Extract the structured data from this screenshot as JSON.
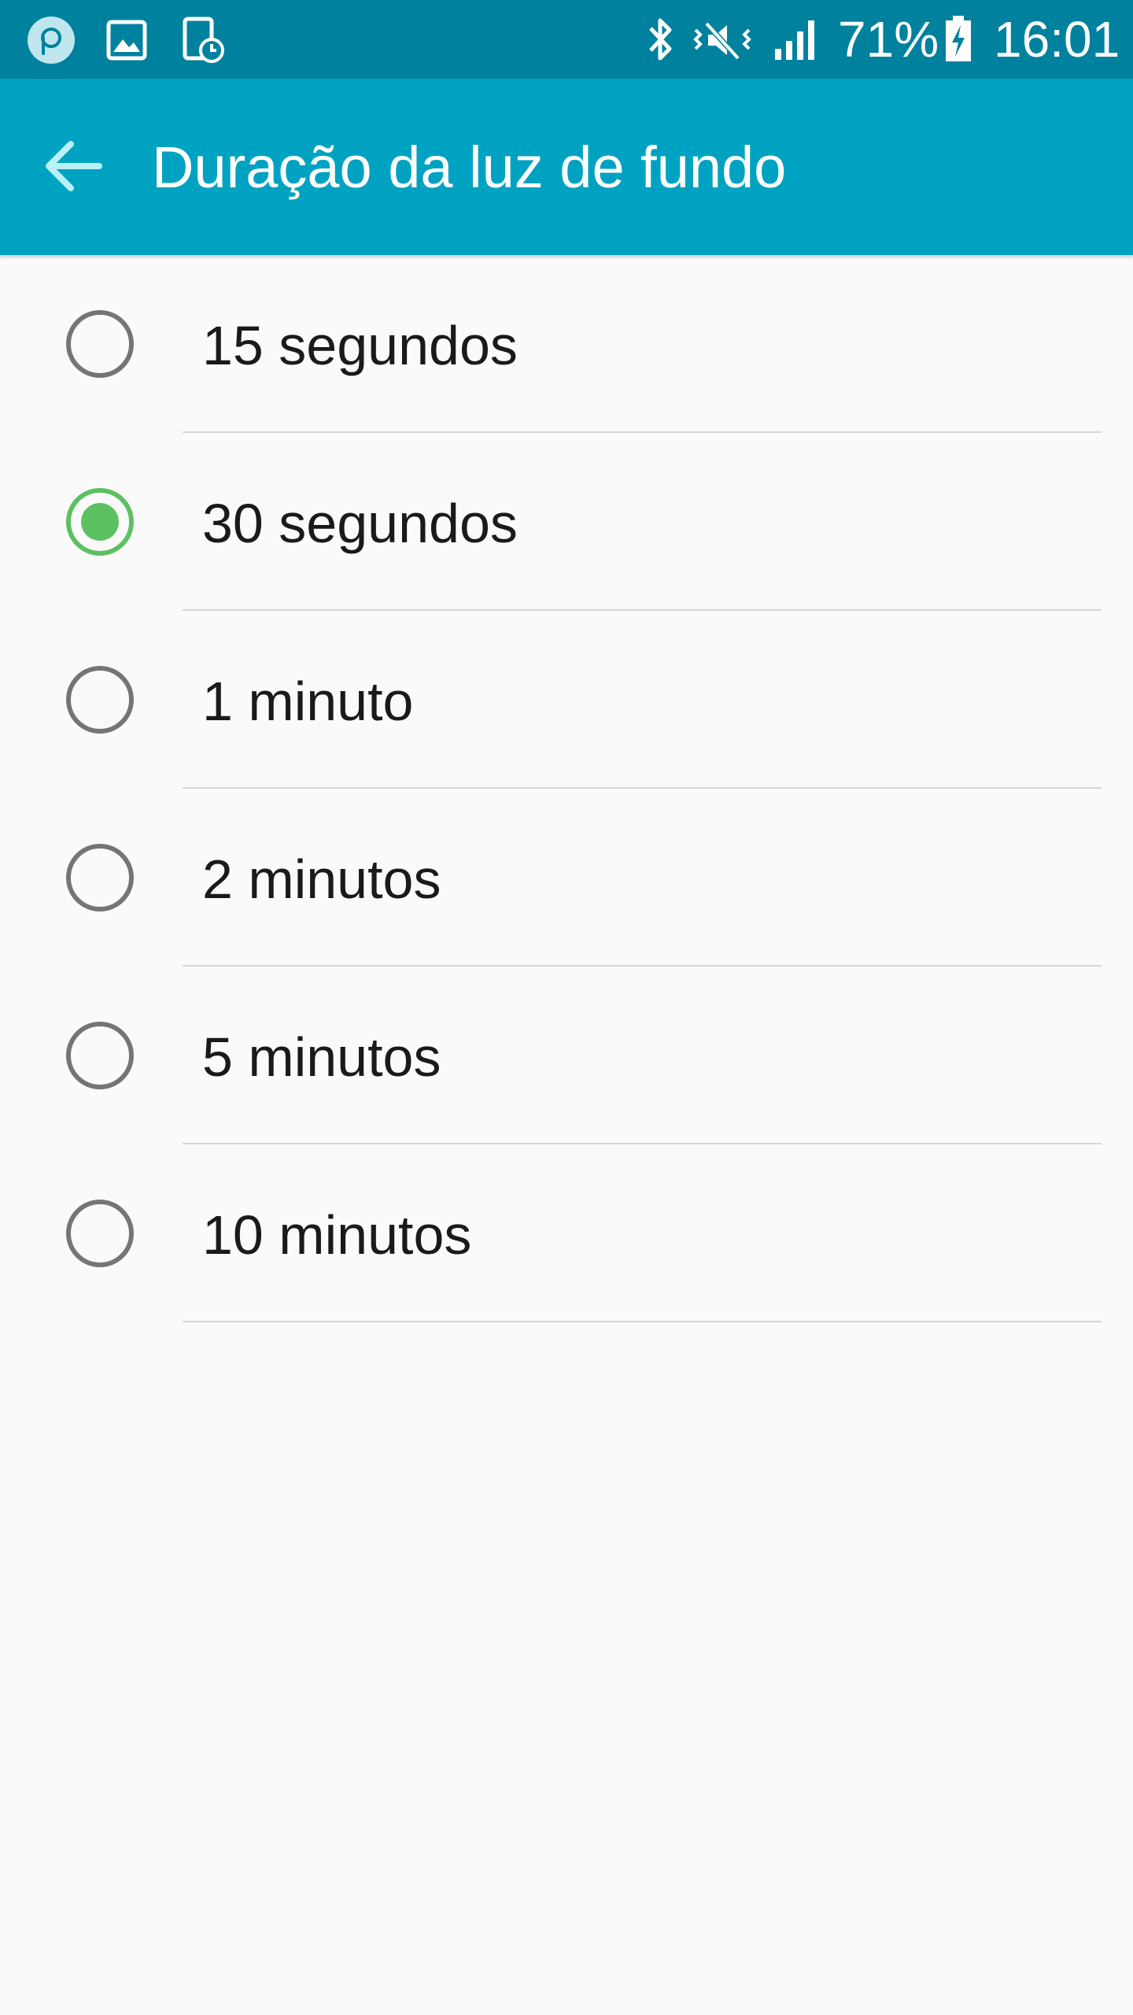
{
  "status_bar": {
    "battery_percent": "71%",
    "time": "16:01",
    "icons": [
      "peel-remote-icon",
      "gallery-icon",
      "screen-timer-icon",
      "bluetooth-icon",
      "vibrate-mute-icon",
      "signal-icon",
      "battery-charging-icon"
    ]
  },
  "app_bar": {
    "title": "Duração da luz de fundo",
    "back_icon": "back-arrow-icon"
  },
  "options": [
    {
      "label": "15 segundos",
      "selected": false
    },
    {
      "label": "30 segundos",
      "selected": true
    },
    {
      "label": "1 minuto",
      "selected": false
    },
    {
      "label": "2 minutos",
      "selected": false
    },
    {
      "label": "5 minutos",
      "selected": false
    },
    {
      "label": "10 minutos",
      "selected": false
    }
  ],
  "colors": {
    "status_bar": "#00819e",
    "app_bar": "#00a2c2",
    "radio_selected": "#5cc160",
    "radio_unselected": "#757575",
    "background": "#fafafa"
  }
}
